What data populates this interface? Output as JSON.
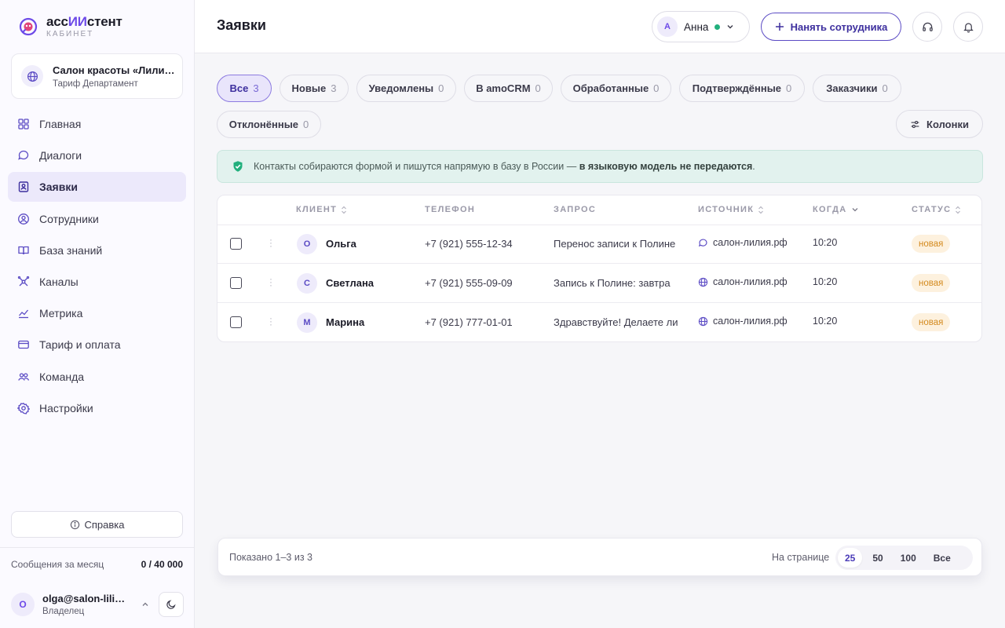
{
  "brand": {
    "title_prefix": "асс",
    "title_highlight": "ИИ",
    "title_suffix": "стент",
    "subtitle": "КАБИНЕТ",
    "accent_color": "#6d4ae8"
  },
  "company": {
    "name": "Салон красоты «Лилия»",
    "plan": "Тариф Департамент"
  },
  "sidebar": {
    "items": [
      {
        "label": "Главная",
        "icon": "grid-icon",
        "active": false
      },
      {
        "label": "Диалоги",
        "icon": "chat-icon",
        "active": false
      },
      {
        "label": "Заявки",
        "icon": "request-icon",
        "active": true
      },
      {
        "label": "Сотрудники",
        "icon": "employee-icon",
        "active": false
      },
      {
        "label": "База знаний",
        "icon": "book-icon",
        "active": false
      },
      {
        "label": "Каналы",
        "icon": "channels-icon",
        "active": false
      },
      {
        "label": "Метрика",
        "icon": "chart-icon",
        "active": false
      },
      {
        "label": "Тариф и оплата",
        "icon": "card-icon",
        "active": false
      },
      {
        "label": "Команда",
        "icon": "team-icon",
        "active": false
      },
      {
        "label": "Настройки",
        "icon": "gear-icon",
        "active": false
      }
    ],
    "help_label": "Справка",
    "usage_label": "Сообщения за месяц",
    "usage_value": "0 / 40 000"
  },
  "user": {
    "initial": "O",
    "email": "olga@salon-liliya.ru",
    "role": "Владелец"
  },
  "header": {
    "title": "Заявки",
    "user_initial": "А",
    "user_name": "Анна",
    "hire_label": "Нанять сотрудника",
    "online_color": "#22b07d"
  },
  "filters": [
    {
      "label": "Все",
      "count": "3",
      "active": true
    },
    {
      "label": "Новые",
      "count": "3",
      "active": false
    },
    {
      "label": "Уведомлены",
      "count": "0",
      "active": false
    },
    {
      "label": "В amoCRM",
      "count": "0",
      "active": false
    },
    {
      "label": "Обработанные",
      "count": "0",
      "active": false
    },
    {
      "label": "Подтверждённые",
      "count": "0",
      "active": false
    },
    {
      "label": "Заказчики",
      "count": "0",
      "active": false
    },
    {
      "label": "Отклонённые",
      "count": "0",
      "active": false
    }
  ],
  "columns_label": "Колонки",
  "notice": {
    "text": "Контакты собираются формой и пишутся напрямую в базу в России — ",
    "bold": "в языковую модель не передаются",
    "end": "."
  },
  "table": {
    "headers": {
      "client": "КЛИЕНТ",
      "phone": "ТЕЛЕФОН",
      "request": "ЗАПРОС",
      "source": "ИСТОЧНИК",
      "when": "КОГДА",
      "status": "СТАТУС"
    },
    "rows": [
      {
        "initial": "О",
        "name": "Ольга",
        "phone": "+7 (921) 555-12-34",
        "request": "Перенос записи к Полине",
        "source_icon": "chat-icon",
        "source": "салон-лилия.рф",
        "when": "10:20",
        "status": "новая"
      },
      {
        "initial": "С",
        "name": "Светлана",
        "phone": "+7 (921) 555-09-09",
        "request": "Запись к Полине: завтра",
        "source_icon": "globe-icon",
        "source": "салон-лилия.рф",
        "when": "10:20",
        "status": "новая"
      },
      {
        "initial": "М",
        "name": "Марина",
        "phone": "+7 (921) 777-01-01",
        "request": "Здравствуйте! Делаете ли",
        "source_icon": "globe-icon",
        "source": "салон-лилия.рф",
        "when": "10:20",
        "status": "новая"
      }
    ]
  },
  "footer": {
    "shown": "Показано 1–3 из 3",
    "per_page_label": "На странице",
    "per_page_options": [
      "25",
      "50",
      "100",
      "Все"
    ],
    "per_page_selected": "25"
  }
}
